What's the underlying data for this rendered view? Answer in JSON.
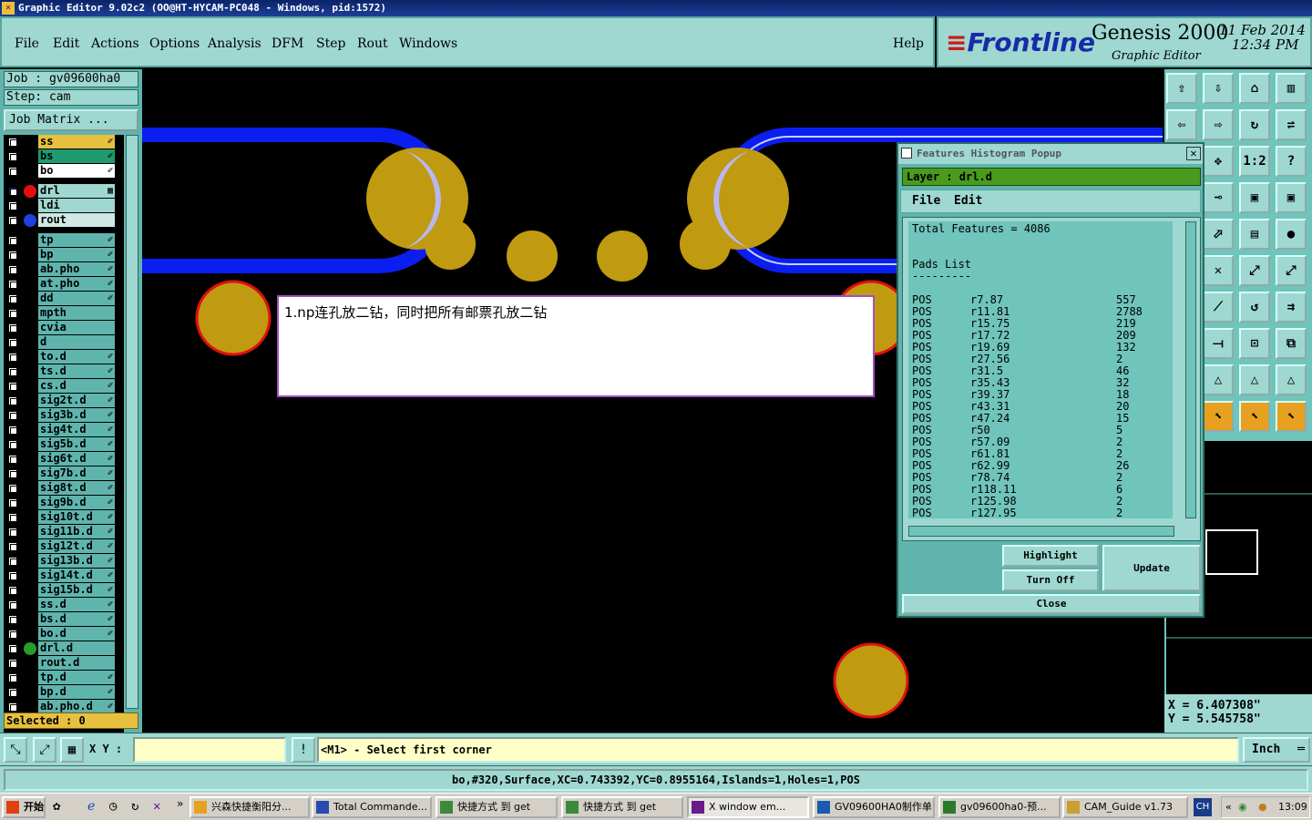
{
  "window": {
    "title": "Graphic Editor 9.02c2  (OO@HT-HYCAM-PC048 - Windows, pid:1572)"
  },
  "menubar": {
    "items": [
      "File",
      "Edit",
      "Actions",
      "Options",
      "Analysis",
      "DFM",
      "Step",
      "Rout",
      "Windows"
    ],
    "help": "Help"
  },
  "brand": {
    "logo": "Frontline",
    "product": "Genesis 2000",
    "subtitle": "Graphic Editor",
    "date": "11 Feb 2014",
    "time": "12:34 PM"
  },
  "job": {
    "job_label": "Job  :  gv09600ha0",
    "step_label": "Step:  cam",
    "matrix_button": "Job Matrix ..."
  },
  "layers": [
    {
      "name": "ss",
      "color": "#e8c040",
      "mark": "✐"
    },
    {
      "name": "bs",
      "color": "#1e9a70",
      "mark": "✐"
    },
    {
      "name": "bo",
      "color": "#ffffff",
      "mark": "✐"
    },
    {
      "name": "drl",
      "color": "#9ed8d0",
      "mark": "▦",
      "dot": "#e01010",
      "cbcolor": "#0a20a0"
    },
    {
      "name": "ldi",
      "color": "#9ed8d0",
      "mark": ""
    },
    {
      "name": "rout",
      "color": "#d0e8e4",
      "mark": "",
      "dot": "#1e40e0"
    },
    {
      "name": "tp",
      "color": "#5fb5ad",
      "mark": "✐"
    },
    {
      "name": "bp",
      "color": "#5fb5ad",
      "mark": "✐"
    },
    {
      "name": "ab.pho",
      "color": "#5fb5ad",
      "mark": "✐"
    },
    {
      "name": "at.pho",
      "color": "#5fb5ad",
      "mark": "✐"
    },
    {
      "name": "dd",
      "color": "#5fb5ad",
      "mark": "✐"
    },
    {
      "name": "mpth",
      "color": "#5fb5ad",
      "mark": ""
    },
    {
      "name": "cvia",
      "color": "#5fb5ad",
      "mark": ""
    },
    {
      "name": "d",
      "color": "#5fb5ad",
      "mark": ""
    },
    {
      "name": "to.d",
      "color": "#5fb5ad",
      "mark": "✐"
    },
    {
      "name": "ts.d",
      "color": "#5fb5ad",
      "mark": "✐"
    },
    {
      "name": "cs.d",
      "color": "#5fb5ad",
      "mark": "✐"
    },
    {
      "name": "sig2t.d",
      "color": "#5fb5ad",
      "mark": "✐"
    },
    {
      "name": "sig3b.d",
      "color": "#5fb5ad",
      "mark": "✐"
    },
    {
      "name": "sig4t.d",
      "color": "#5fb5ad",
      "mark": "✐"
    },
    {
      "name": "sig5b.d",
      "color": "#5fb5ad",
      "mark": "✐"
    },
    {
      "name": "sig6t.d",
      "color": "#5fb5ad",
      "mark": "✐"
    },
    {
      "name": "sig7b.d",
      "color": "#5fb5ad",
      "mark": "✐"
    },
    {
      "name": "sig8t.d",
      "color": "#5fb5ad",
      "mark": "✐"
    },
    {
      "name": "sig9b.d",
      "color": "#5fb5ad",
      "mark": "✐"
    },
    {
      "name": "sig10t.d",
      "color": "#5fb5ad",
      "mark": "✐"
    },
    {
      "name": "sig11b.d",
      "color": "#5fb5ad",
      "mark": "✐"
    },
    {
      "name": "sig12t.d",
      "color": "#5fb5ad",
      "mark": "✐"
    },
    {
      "name": "sig13b.d",
      "color": "#5fb5ad",
      "mark": "✐"
    },
    {
      "name": "sig14t.d",
      "color": "#5fb5ad",
      "mark": "✐"
    },
    {
      "name": "sig15b.d",
      "color": "#5fb5ad",
      "mark": "✐"
    },
    {
      "name": "ss.d",
      "color": "#5fb5ad",
      "mark": "✐"
    },
    {
      "name": "bs.d",
      "color": "#5fb5ad",
      "mark": "✐"
    },
    {
      "name": "bo.d",
      "color": "#5fb5ad",
      "mark": "✐"
    },
    {
      "name": "drl.d",
      "color": "#5fb5ad",
      "mark": "",
      "dot": "#2a9a2a"
    },
    {
      "name": "rout.d",
      "color": "#5fb5ad",
      "mark": ""
    },
    {
      "name": "tp.d",
      "color": "#5fb5ad",
      "mark": "✐"
    },
    {
      "name": "bp.d",
      "color": "#5fb5ad",
      "mark": "✐"
    },
    {
      "name": "ab.pho.d",
      "color": "#5fb5ad",
      "mark": "✐"
    }
  ],
  "selected": "Selected : 0",
  "note": {
    "text": "1.np连孔放二钻，同时把所有邮票孔放二钻"
  },
  "popup": {
    "title": "Features Histogram Popup",
    "layer": "Layer :  drl.d",
    "menu": [
      "File",
      "Edit"
    ],
    "total": "Total Features = 4086",
    "list_title": "Pads List",
    "list_rule": "---------",
    "rows": [
      [
        "POS",
        "r7.87",
        "557"
      ],
      [
        "POS",
        "r11.81",
        "2788"
      ],
      [
        "POS",
        "r15.75",
        "219"
      ],
      [
        "POS",
        "r17.72",
        "209"
      ],
      [
        "POS",
        "r19.69",
        "132"
      ],
      [
        "POS",
        "r27.56",
        "2"
      ],
      [
        "POS",
        "r31.5",
        "46"
      ],
      [
        "POS",
        "r35.43",
        "32"
      ],
      [
        "POS",
        "r39.37",
        "18"
      ],
      [
        "POS",
        "r43.31",
        "20"
      ],
      [
        "POS",
        "r47.24",
        "15"
      ],
      [
        "POS",
        "r50",
        "5"
      ],
      [
        "POS",
        "r57.09",
        "2"
      ],
      [
        "POS",
        "r61.81",
        "2"
      ],
      [
        "POS",
        "r62.99",
        "26"
      ],
      [
        "POS",
        "r78.74",
        "2"
      ],
      [
        "POS",
        "r118.11",
        "6"
      ],
      [
        "POS",
        "r125.98",
        "2"
      ],
      [
        "POS",
        "r127.95",
        "2"
      ]
    ],
    "highlight": "Highlight",
    "turn_off": "Turn Off",
    "update": "Update",
    "close": "Close"
  },
  "coords": {
    "x": "X  =  6.407308\"",
    "y": "Y  =  5.545758\""
  },
  "toolbar_glyphs": [
    "⇧",
    "⇩",
    "⌂",
    "▥",
    "⇦",
    "⇨",
    "↻",
    "⇌",
    "✥",
    "1:2",
    "?",
    "⊸",
    "▣",
    "▣",
    "⬀",
    "▤",
    "●",
    "✕",
    "⤢",
    "⤢",
    "⟋",
    "↺",
    "⇉",
    "⟞",
    "⊡",
    "⧉",
    "△",
    "△",
    "△",
    "⬉",
    "⬉",
    "⬉"
  ],
  "cmd": {
    "xy_label": "X Y :",
    "xy_value": "",
    "prompt": "<M1> - Select first corner",
    "unit": "Inch"
  },
  "status": "bo,#320,Surface,XC=0.743392,YC=0.8955164,Islands=1,Holes=1,POS",
  "taskbar": {
    "start": "开始",
    "tasks": [
      "兴森快捷衡阳分...",
      "Total Commande...",
      "快捷方式 到 get",
      "快捷方式 到 get",
      "X window em...",
      "GV09600HA0制作单",
      "gv09600ha0-预...",
      "CAM_Guide v1.73"
    ],
    "lang": "CH",
    "clock": "13:09"
  },
  "colors": {
    "panel": "#9ed8d0",
    "panel_dark": "#5fb5ad",
    "trace": "#0a1ef0",
    "pad": "#c09a10",
    "pad_outline": "#e01010"
  }
}
